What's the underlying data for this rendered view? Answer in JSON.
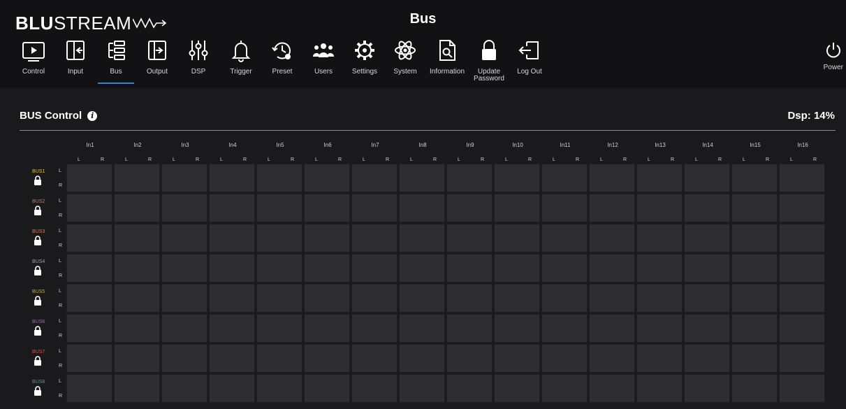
{
  "app": {
    "logo_bold": "BLU",
    "logo_light": "STREAM",
    "title": "Bus"
  },
  "nav": [
    {
      "label": "Control",
      "icon": "display-icon"
    },
    {
      "label": "Input",
      "icon": "input-icon"
    },
    {
      "label": "Bus",
      "icon": "bus-icon",
      "active": true
    },
    {
      "label": "Output",
      "icon": "output-icon"
    },
    {
      "label": "DSP",
      "icon": "sliders-icon"
    },
    {
      "label": "Trigger",
      "icon": "bell-icon"
    },
    {
      "label": "Preset",
      "icon": "preset-icon"
    },
    {
      "label": "Users",
      "icon": "users-icon"
    },
    {
      "label": "Settings",
      "icon": "gear-icon"
    },
    {
      "label": "System",
      "icon": "atom-icon"
    },
    {
      "label": "Information",
      "icon": "document-search-icon"
    },
    {
      "label": "Update\nPassword",
      "icon": "lock-icon"
    },
    {
      "label": "Log Out",
      "icon": "logout-icon"
    }
  ],
  "power": {
    "label": "Power",
    "icon": "power-icon"
  },
  "section": {
    "title": "BUS Control",
    "info_glyph": "i",
    "dsp": "Dsp: 14%"
  },
  "channels": {
    "left": "L",
    "right": "R"
  },
  "inputs": [
    "In1",
    "In2",
    "In3",
    "In4",
    "In5",
    "In6",
    "In7",
    "In8",
    "In9",
    "In10",
    "In11",
    "In12",
    "In13",
    "In14",
    "In15",
    "In16"
  ],
  "buses": [
    {
      "label": "BUS1",
      "color": "#e8c040"
    },
    {
      "label": "BUS2",
      "color": "#e07a3c"
    },
    {
      "label": "BUS3",
      "color": "#e07a60"
    },
    {
      "label": "BUS4",
      "color": "#a89cc8"
    },
    {
      "label": "BUS5",
      "color": "#b8b040"
    },
    {
      "label": "BUS6",
      "color": "#b060c0"
    },
    {
      "label": "BUS7",
      "color": "#e05050"
    },
    {
      "label": "BUS8",
      "color": "#4aa0a8"
    }
  ]
}
